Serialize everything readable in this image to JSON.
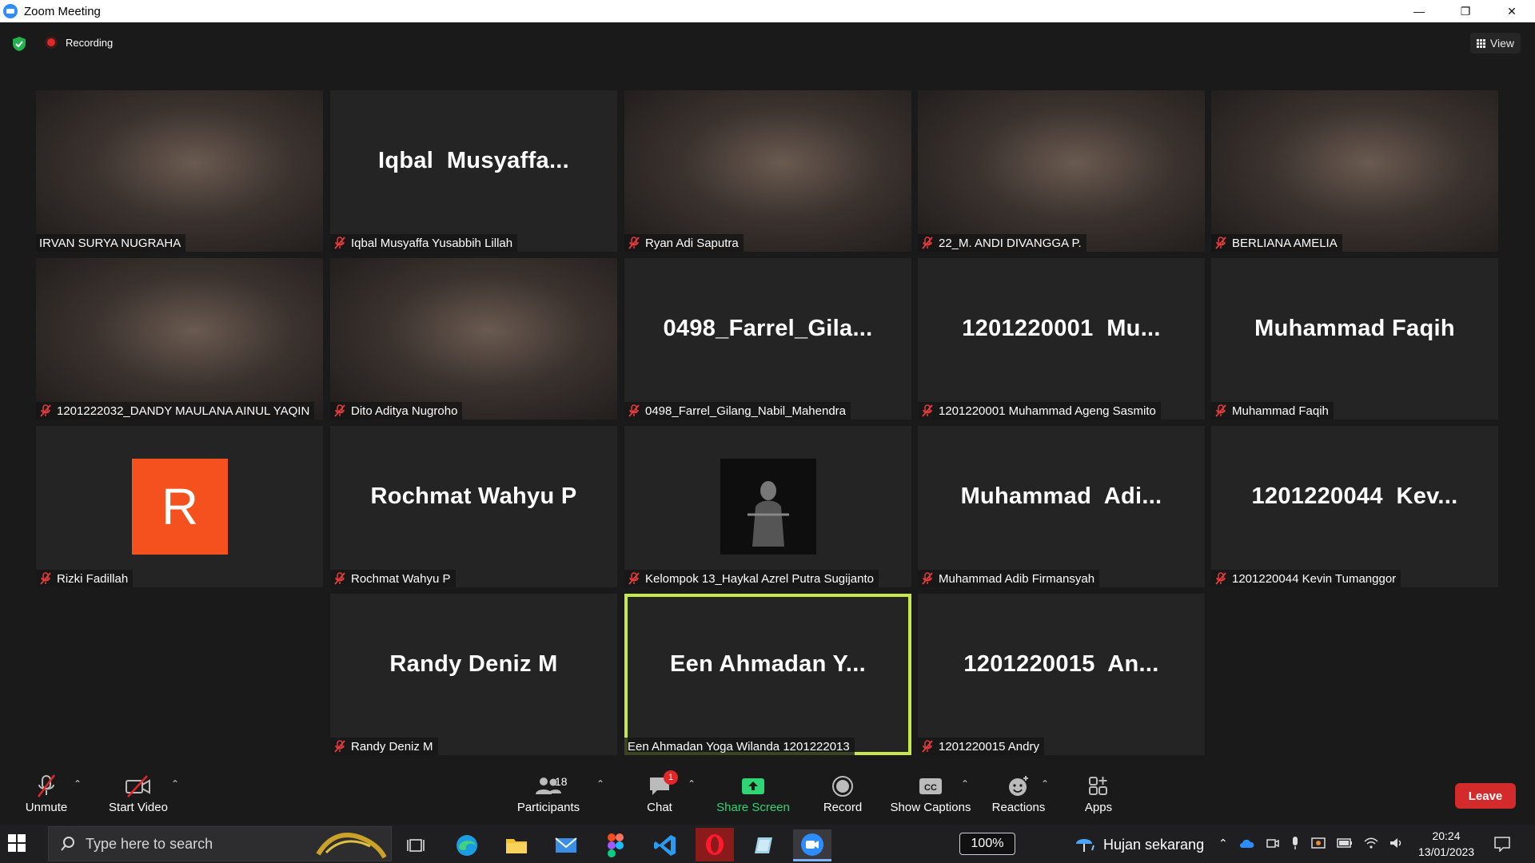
{
  "window": {
    "title": "Zoom Meeting"
  },
  "header": {
    "recording_label": "Recording",
    "view_label": "View"
  },
  "tiles": [
    {
      "display_name": "",
      "name_tag": "IRVAN SURYA NUGRAHA",
      "muted": false,
      "video": "camera"
    },
    {
      "display_name": "Iqbal  Musyaffa...",
      "name_tag": "Iqbal Musyaffa Yusabbih Lillah",
      "muted": true,
      "video": "off"
    },
    {
      "display_name": "",
      "name_tag": "Ryan Adi Saputra",
      "muted": true,
      "video": "camera"
    },
    {
      "display_name": "",
      "name_tag": "22_M. ANDI DIVANGGA P.",
      "muted": true,
      "video": "camera"
    },
    {
      "display_name": "",
      "name_tag": "BERLIANA AMELIA",
      "muted": true,
      "video": "camera"
    },
    {
      "display_name": "",
      "name_tag": "1201222032_DANDY MAULANA AINUL YAQIN",
      "muted": true,
      "video": "camera"
    },
    {
      "display_name": "",
      "name_tag": "Dito Aditya Nugroho",
      "muted": true,
      "video": "camera"
    },
    {
      "display_name": "0498_Farrel_Gila...",
      "name_tag": "0498_Farrel_Gilang_Nabil_Mahendra",
      "muted": true,
      "video": "off"
    },
    {
      "display_name": "1201220001  Mu...",
      "name_tag": "1201220001 Muhammad Ageng Sasmito",
      "muted": true,
      "video": "off"
    },
    {
      "display_name": "Muhammad Faqih",
      "name_tag": "Muhammad Faqih",
      "muted": true,
      "video": "off"
    },
    {
      "display_name": "",
      "avatar_letter": "R",
      "name_tag": "Rizki Fadillah",
      "muted": true,
      "video": "avatar"
    },
    {
      "display_name": "Rochmat Wahyu P",
      "name_tag": "Rochmat Wahyu P",
      "muted": true,
      "video": "off"
    },
    {
      "display_name": "",
      "name_tag": "Kelompok 13_Haykal Azrel Putra Sugijanto",
      "muted": true,
      "video": "avatar-picture"
    },
    {
      "display_name": "Muhammad  Adi...",
      "name_tag": "Muhammad Adib Firmansyah",
      "muted": true,
      "video": "off"
    },
    {
      "display_name": "1201220044  Kev...",
      "name_tag": "1201220044 Kevin Tumanggor",
      "muted": true,
      "video": "off"
    },
    {
      "display_name": "Randy Deniz M",
      "name_tag": "Randy Deniz M",
      "muted": true,
      "video": "off"
    },
    {
      "display_name": "Een Ahmadan Y...",
      "name_tag": "Een Ahmadan Yoga Wilanda 1201222013",
      "muted": false,
      "video": "off",
      "active_speaker": true
    },
    {
      "display_name": "1201220015  An...",
      "name_tag": "1201220015 Andry",
      "muted": true,
      "video": "off"
    }
  ],
  "toolbar": {
    "unmute": "Unmute",
    "start_video": "Start Video",
    "participants": "Participants",
    "participants_count": "18",
    "chat": "Chat",
    "chat_badge": "1",
    "share_screen": "Share Screen",
    "record": "Record",
    "show_captions": "Show Captions",
    "reactions": "Reactions",
    "apps": "Apps",
    "leave": "Leave"
  },
  "taskbar": {
    "search_placeholder": "Type here to search",
    "zoom_level": "100%",
    "weather": "Hujan sekarang",
    "time": "20:24",
    "date": "13/01/2023",
    "apps": [
      "task-view-icon",
      "edge-icon",
      "file-explorer-icon",
      "mail-icon",
      "figma-icon",
      "vscode-icon",
      "opera-icon",
      "notes-icon",
      "zoom-icon"
    ]
  },
  "colors": {
    "active_speaker_border": "#c6e84a",
    "share_green": "#2ed573",
    "leave_red": "#d32b2b",
    "avatar_orange": "#f4511e"
  }
}
